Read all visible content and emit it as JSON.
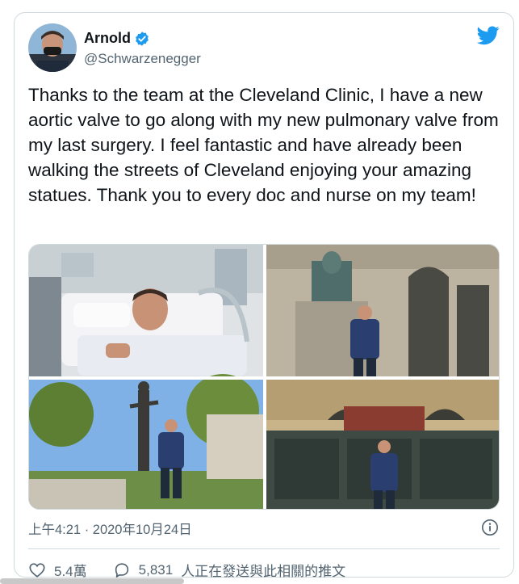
{
  "author": {
    "name": "Arnold",
    "handle": "@Schwarzenegger",
    "verified": true,
    "avatar": "avatar-icon"
  },
  "brand": {
    "logo": "twitter-bird-icon",
    "color": "#1d9bf0"
  },
  "tweet": {
    "text": "Thanks to the team at the Cleveland Clinic, I have a new aortic valve to go along with my new pulmonary valve from my last surgery. I feel fantastic and have already been walking the streets of Cleveland enjoying your amazing statues. Thank you to every doc and nurse on my team!"
  },
  "media": [
    {
      "kind": "photo",
      "scene": "hospital-bed"
    },
    {
      "kind": "photo",
      "scene": "statue-building"
    },
    {
      "kind": "photo",
      "scene": "statue-park"
    },
    {
      "kind": "photo",
      "scene": "memorial-wall"
    }
  ],
  "timestamp": "上午4:21 · 2020年10月24日",
  "info_icon": "info-icon",
  "actions": {
    "likes": "5.4萬",
    "like_icon": "heart-icon",
    "replies_count": "5,831",
    "replies_text": "人正在發送與此相關的推文",
    "reply_icon": "speech-bubble-icon"
  }
}
